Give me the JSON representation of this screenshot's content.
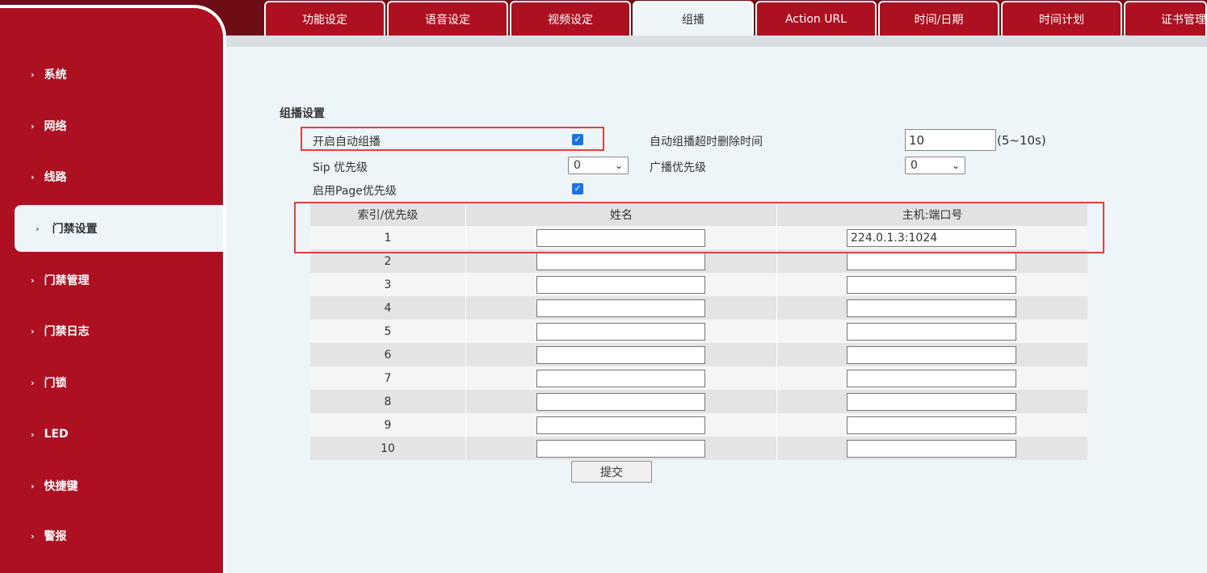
{
  "tabs": [
    {
      "label": "功能设定",
      "active": false
    },
    {
      "label": "语音设定",
      "active": false
    },
    {
      "label": "视频设定",
      "active": false
    },
    {
      "label": "组播",
      "active": true
    },
    {
      "label": "Action URL",
      "active": false
    },
    {
      "label": "时间/日期",
      "active": false
    },
    {
      "label": "时间计划",
      "active": false
    },
    {
      "label": "证书管理",
      "active": false
    }
  ],
  "sidebar": {
    "items": [
      {
        "label": "系统"
      },
      {
        "label": "网络"
      },
      {
        "label": "线路"
      },
      {
        "label": "门禁设置",
        "active": true
      },
      {
        "label": "门禁管理"
      },
      {
        "label": "门禁日志"
      },
      {
        "label": "门锁"
      },
      {
        "label": "LED"
      },
      {
        "label": "快捷键"
      },
      {
        "label": "警报"
      }
    ]
  },
  "multicast": {
    "section_title": "组播设置",
    "auto_multicast_label": "开启自动组播",
    "auto_multicast_checked": true,
    "timeout_label": "自动组播超时删除时间",
    "timeout_value": "10",
    "timeout_range": "(5~10s)",
    "sip_priority_label": "Sip 优先级",
    "sip_priority_value": "0",
    "broadcast_priority_label": "广播优先级",
    "broadcast_priority_value": "0",
    "page_priority_label": "启用Page优先级",
    "page_priority_checked": true
  },
  "table": {
    "headers": [
      "索引/优先级",
      "姓名",
      "主机:端口号"
    ],
    "rows": [
      {
        "index": "1",
        "name": "",
        "host": "224.0.1.3:1024"
      },
      {
        "index": "2",
        "name": "",
        "host": ""
      },
      {
        "index": "3",
        "name": "",
        "host": ""
      },
      {
        "index": "4",
        "name": "",
        "host": ""
      },
      {
        "index": "5",
        "name": "",
        "host": ""
      },
      {
        "index": "6",
        "name": "",
        "host": ""
      },
      {
        "index": "7",
        "name": "",
        "host": ""
      },
      {
        "index": "8",
        "name": "",
        "host": ""
      },
      {
        "index": "9",
        "name": "",
        "host": ""
      },
      {
        "index": "10",
        "name": "",
        "host": ""
      }
    ]
  },
  "submit_label": "提交",
  "colors": {
    "brand_red": "#ad1020",
    "highlight_box": "#e0403f",
    "checkbox_blue": "#1a73e8"
  }
}
